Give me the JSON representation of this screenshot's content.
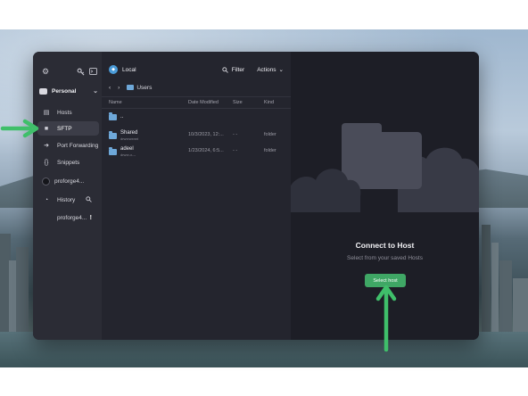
{
  "colors": {
    "accent_green": "#3fa765",
    "annotation_arrow": "#3fbf6a",
    "folder_blue": "#6ea8d9",
    "window_bg": "#1f2028"
  },
  "sidebar": {
    "vault_name": "Personal",
    "nav": [
      {
        "label": "Hosts",
        "icon": "hosts-icon"
      },
      {
        "label": "SFTP",
        "icon": "folder-icon",
        "active": true
      },
      {
        "label": "Port Forwarding",
        "icon": "arrow-right-icon"
      },
      {
        "label": "Snippets",
        "icon": "braces-icon"
      },
      {
        "label": "proforge4...",
        "icon": "host-dot-icon"
      },
      {
        "label": "History",
        "icon": "clock-icon"
      },
      {
        "label": "proforge4...",
        "icon": "none",
        "trail": "!"
      }
    ]
  },
  "filepane": {
    "location": "Local",
    "filter_label": "Filter",
    "actions_label": "Actions",
    "breadcrumb": "Users",
    "columns": {
      "name": "Name",
      "modified": "Date Modified",
      "size": "Size",
      "kind": "Kind"
    },
    "rows": [
      {
        "name": "..",
        "sub": "",
        "modified": "",
        "size": "",
        "kind": ""
      },
      {
        "name": "Shared",
        "sub": "drwxrwxrwt",
        "modified": "10/3/2023, 12:...",
        "size": "- -",
        "kind": "folder"
      },
      {
        "name": "adeel",
        "sub": "drwxr-x---",
        "modified": "1/23/2024, 6:5...",
        "size": "- -",
        "kind": "folder"
      }
    ]
  },
  "hostpane": {
    "title": "Connect to Host",
    "subtitle": "Select from your saved Hosts",
    "button_label": "Select host"
  }
}
